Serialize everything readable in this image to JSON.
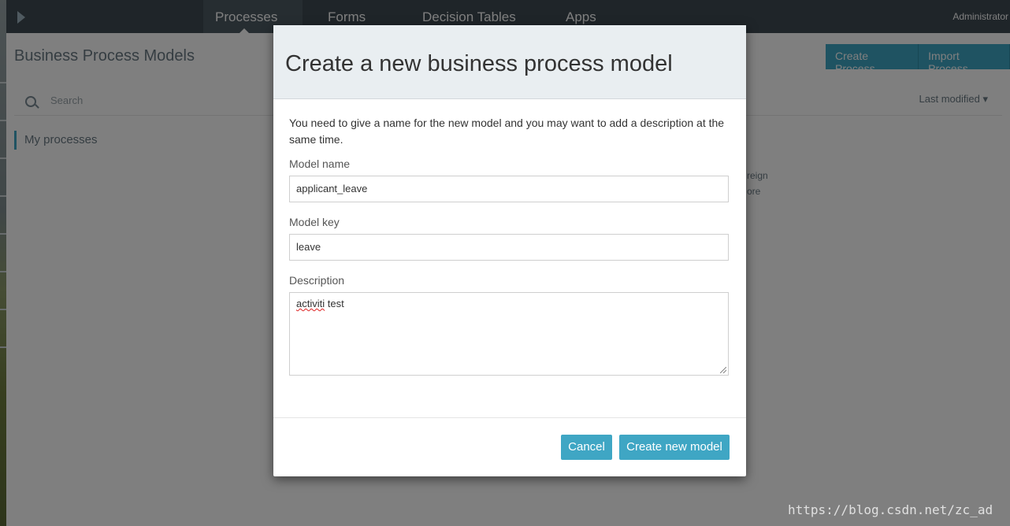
{
  "topbar": {
    "nav": [
      {
        "label": "Processes",
        "active": true
      },
      {
        "label": "Forms"
      },
      {
        "label": "Decision Tables"
      },
      {
        "label": "Apps"
      }
    ],
    "user": "Administrator"
  },
  "page": {
    "title": "Business Process Models",
    "buttons": [
      "Create Process",
      "Import Process"
    ],
    "search_placeholder": "Search",
    "sort": "Last modified ▾",
    "sidebar_item": "My processes",
    "fragments": [
      "reign",
      "ore"
    ]
  },
  "modal": {
    "title": "Create a new business process model",
    "intro": "You need to give a name for the new model and you may want to add a description at the same time.",
    "model_name_label": "Model name",
    "model_name_value": "applicant_leave",
    "model_key_label": "Model key",
    "model_key_value": "leave",
    "description_label": "Description",
    "description_value_word1": "activiti",
    "description_value_word2": " test",
    "cancel": "Cancel",
    "create": "Create new model"
  },
  "watermark": "https://blog.csdn.net/zc_ad",
  "colors": {
    "accent": "#3fa6c4",
    "topbar": "#3e4a52",
    "modal_header": "#e9eef1"
  }
}
